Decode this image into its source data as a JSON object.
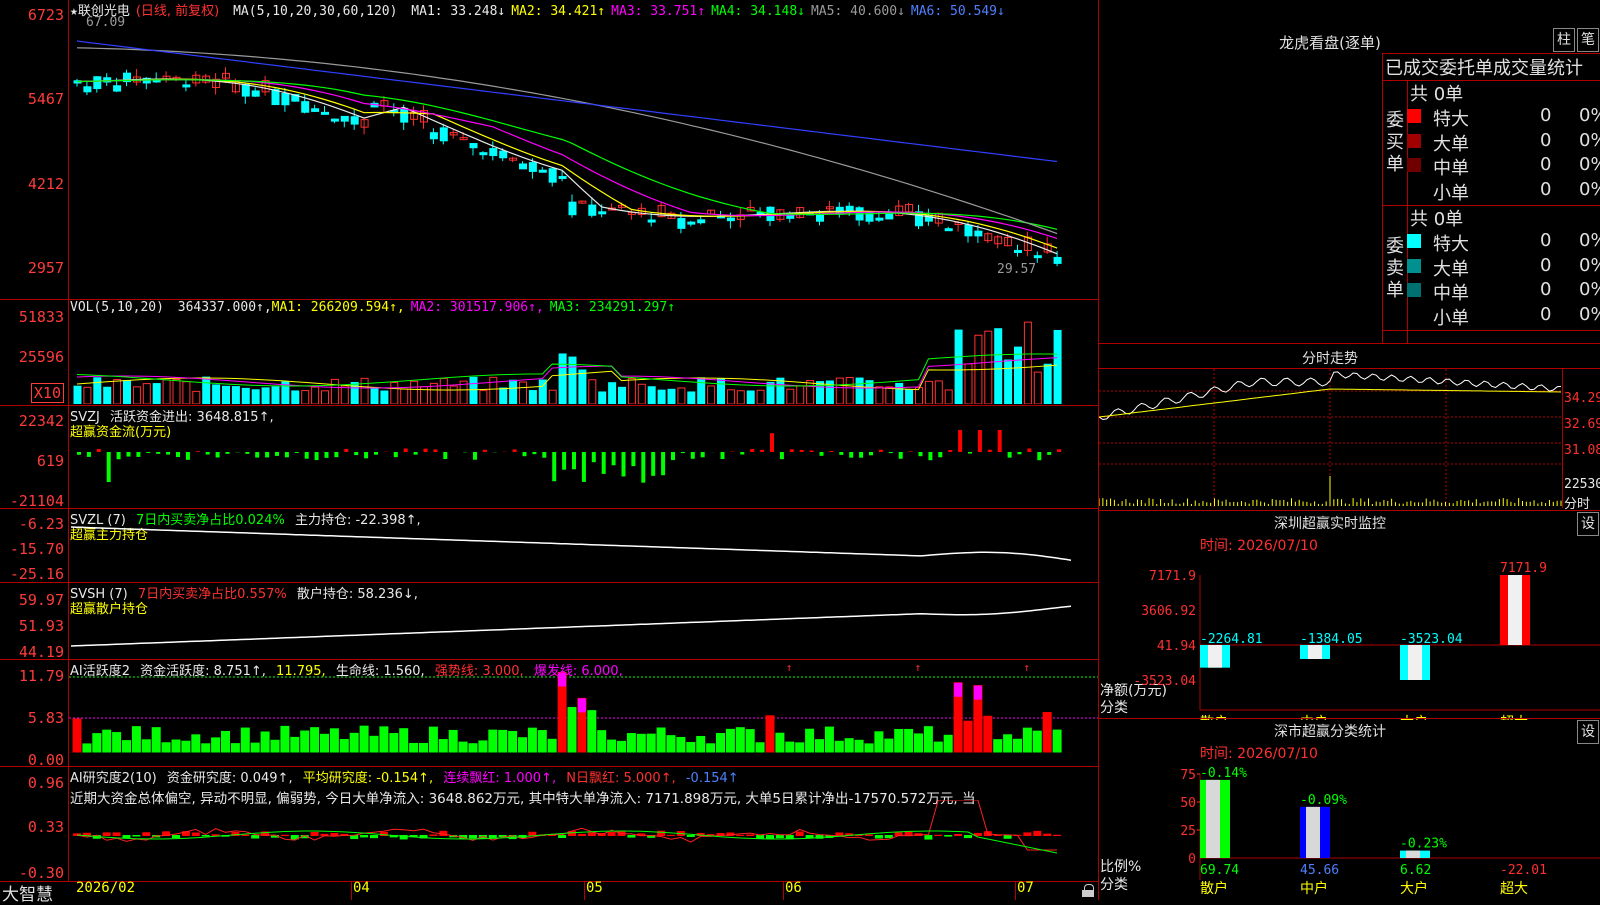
{
  "header": {
    "star": "★",
    "stock_name": "联创光电",
    "period": "(日线, 前复权)",
    "ma_label": "MA(5,10,20,30,60,120)",
    "ma": [
      {
        "text": "MA1: 33.248↓",
        "color": "#e8e8e8"
      },
      {
        "text": "MA2: 34.421↑",
        "color": "#ffff00"
      },
      {
        "text": "MA3: 33.751↑",
        "color": "#ff00ff"
      },
      {
        "text": "MA4: 34.148↓",
        "color": "#00ff00"
      },
      {
        "text": "MA5: 40.600↓",
        "color": "#9a9a9a"
      },
      {
        "text": "MA6: 50.549↓",
        "color": "#5080ff"
      }
    ],
    "high_marker": "67.09",
    "low_marker": "29.57"
  },
  "price_axis": [
    "6723",
    "5467",
    "4212",
    "2957"
  ],
  "vol": {
    "label": "VOL(5,10,20)",
    "value": "364337.000↑,",
    "ma1": "MA1: 266209.594↑,",
    "ma2": "MA2: 301517.906↑,",
    "ma3": "MA3: 234291.297↑",
    "axis": [
      "51833",
      "25596",
      "X10"
    ]
  },
  "svzj": {
    "label": "SVZJ",
    "text1": "活跃资金进出: 3648.815↑,",
    "subtitle": "超赢资金流(万元)",
    "axis": [
      "22342",
      "619",
      "-21104"
    ]
  },
  "svzl": {
    "label": "SVZL (7)",
    "text1": "7日内买卖净占比0.024%",
    "text2": "主力持仓: -22.398↑,",
    "subtitle": "超赢主力持仓",
    "axis": [
      "-6.23",
      "-15.70",
      "-25.16"
    ]
  },
  "svsh": {
    "label": "SVSH (7)",
    "text1": "7日内买卖净占比0.557%",
    "text2": "散户持仓: 58.236↓,",
    "subtitle": "超赢散户持仓",
    "axis": [
      "59.97",
      "51.93",
      "44.19"
    ]
  },
  "ai_active": {
    "label": "AI活跃度2",
    "t1": "资金活跃度: 8.751↑,",
    "t2": "11.795,",
    "t3": "生命线: 1.560,",
    "t4": "强势线: 3.000,",
    "t5": "爆发线: 6.000,",
    "axis": [
      "11.79",
      "5.83",
      "0.00"
    ]
  },
  "ai_research": {
    "label": "AI研究度2(10)",
    "t1": "资金研究度: 0.049↑,",
    "t2": "平均研究度: -0.154↑,",
    "t3": "连续飘红: 1.000↑,",
    "t4": "N日飘红: 5.000↑,",
    "t5": "-0.154↑",
    "desc": "近期大资金总体偏空, 异动不明显, 偏弱势, 今日大单净流入: 3648.862万元, 其中特大单净流入: 7171.898万元, 大单5日累计净出-17570.572万元, 当",
    "axis": [
      "0.96",
      "0.33",
      "-0.30"
    ]
  },
  "x_axis": {
    "brand": "大智慧",
    "labels": [
      "2026/02",
      "04",
      "05",
      "06",
      "07"
    ]
  },
  "longhu": {
    "title": "龙虎看盘(逐单)",
    "btn_zhu": "柱",
    "btn_bi": "笔",
    "subtitle": "已成交委托单成交量统计",
    "buy_side": "委买单",
    "sell_side": "委卖单",
    "buy_total": "共 0单",
    "sell_total": "共 0单",
    "buy_rows": [
      {
        "label": "特大",
        "count": "0",
        "pct": "0%",
        "color": "#ff0000"
      },
      {
        "label": "大单",
        "count": "0",
        "pct": "0%",
        "color": "#a00000"
      },
      {
        "label": "中单",
        "count": "0",
        "pct": "0%",
        "color": "#700000"
      },
      {
        "label": "小单",
        "count": "0",
        "pct": "0%",
        "color": ""
      }
    ],
    "sell_rows": [
      {
        "label": "特大",
        "count": "0",
        "pct": "0%",
        "color": "#00ffff"
      },
      {
        "label": "大单",
        "count": "0",
        "pct": "0%",
        "color": "#009090"
      },
      {
        "label": "中单",
        "count": "0",
        "pct": "0%",
        "color": "#007070"
      },
      {
        "label": "小单",
        "count": "0",
        "pct": "0%",
        "color": ""
      }
    ]
  },
  "intraday": {
    "title": "分时走势",
    "axis": [
      "34.29",
      "32.69",
      "31.08",
      "22530",
      "分时"
    ]
  },
  "sz_monitor": {
    "title": "深圳超赢实时监控",
    "btn": "设",
    "time": "时间: 2026/07/10",
    "axis": [
      "7171.9",
      "3606.92",
      "41.94",
      "-3523.04"
    ],
    "ylabel": "净额(万元)",
    "xlabel": "分类",
    "chart_data": {
      "type": "bar",
      "categories": [
        "散户",
        "中户",
        "大户",
        "超大"
      ],
      "values": [
        -2264.81,
        -1384.05,
        -3523.04,
        7171.9
      ],
      "value_labels": [
        "-2264.81",
        "-1384.05",
        "-3523.04",
        "7171.9"
      ],
      "ylim": [
        -3523.04,
        7171.9
      ]
    }
  },
  "sz_class": {
    "title": "深市超赢分类统计",
    "btn": "设",
    "time": "时间: 2026/07/10",
    "axis": [
      "75",
      "50",
      "25",
      "0"
    ],
    "ylabel": "比例%",
    "xlabel": "分类",
    "chart_data": {
      "type": "bar",
      "categories": [
        "散户",
        "中户",
        "大户",
        "超大"
      ],
      "values": [
        69.74,
        45.66,
        6.62,
        -22.01
      ],
      "value_labels": [
        "69.74",
        "45.66",
        "6.62",
        "-22.01"
      ],
      "change_labels": [
        "-0.14%",
        "-0.09%",
        "-0.23%",
        ""
      ],
      "ylim": [
        0,
        75
      ]
    }
  }
}
